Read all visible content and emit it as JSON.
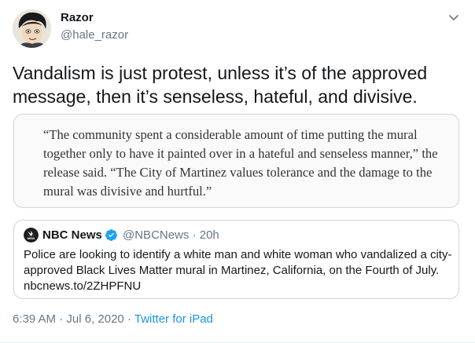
{
  "author": {
    "name": "Razor",
    "handle": "@hale_razor"
  },
  "tweet": {
    "text": "Vandalism is just protest, unless it’s of the approved message, then it’s senseless, hateful, and divisive."
  },
  "quote_image": {
    "text": "“The community spent a considerable amount of time putting the mural together only to have it painted over in a hateful and senseless manner,” the release said. “The City of Martinez values tolerance and the damage to the mural was divisive and hurtful.”"
  },
  "embedded_tweet": {
    "name": "NBC News",
    "handle": "@NBCNews",
    "separator": "·",
    "time": "20h",
    "text": "Police are looking to identify a white man and white woman who vandalized a city-approved Black Lives Matter mural in Martinez, California, on the Fourth of July.",
    "link": "nbcnews.to/2ZHPFNU"
  },
  "footer": {
    "time": "6:39 AM",
    "separator1": "·",
    "date": "Jul 6, 2020",
    "separator2": "·",
    "source": "Twitter for iPad"
  },
  "icons": {
    "caret": "chevron-down-icon",
    "verified": "verified-badge-icon",
    "nbc_logo": "nbc-peacock-logo"
  },
  "colors": {
    "primary_text": "#14171a",
    "secondary_text": "#657786",
    "link": "#1b95e0",
    "verified": "#1da1f2",
    "border": "#ccd6dd"
  }
}
